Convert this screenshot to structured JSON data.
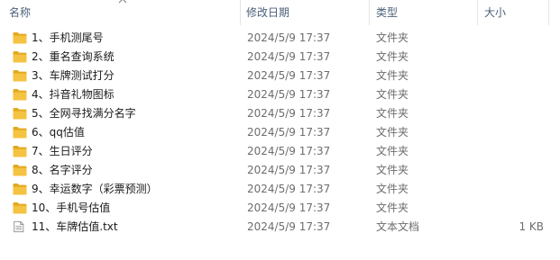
{
  "columns": {
    "name": "名称",
    "date": "修改日期",
    "type": "类型",
    "size": "大小"
  },
  "colors": {
    "folder": "#f5c342",
    "folder_dark": "#e3a91e",
    "header_text": "#4c607a"
  },
  "files": [
    {
      "name": "1、手机测尾号",
      "date": "2024/5/9 17:37",
      "type": "文件夹",
      "size": "",
      "icon": "folder-icon"
    },
    {
      "name": "2、重名查询系统",
      "date": "2024/5/9 17:37",
      "type": "文件夹",
      "size": "",
      "icon": "folder-icon"
    },
    {
      "name": "3、车牌测试打分",
      "date": "2024/5/9 17:37",
      "type": "文件夹",
      "size": "",
      "icon": "folder-icon"
    },
    {
      "name": "4、抖音礼物图标",
      "date": "2024/5/9 17:37",
      "type": "文件夹",
      "size": "",
      "icon": "folder-icon"
    },
    {
      "name": "5、全网寻找满分名字",
      "date": "2024/5/9 17:37",
      "type": "文件夹",
      "size": "",
      "icon": "folder-icon"
    },
    {
      "name": "6、qq估值",
      "date": "2024/5/9 17:37",
      "type": "文件夹",
      "size": "",
      "icon": "folder-icon"
    },
    {
      "name": "7、生日评分",
      "date": "2024/5/9 17:37",
      "type": "文件夹",
      "size": "",
      "icon": "folder-icon"
    },
    {
      "name": "8、名字评分",
      "date": "2024/5/9 17:37",
      "type": "文件夹",
      "size": "",
      "icon": "folder-icon"
    },
    {
      "name": "9、幸运数字（彩票预测）",
      "date": "2024/5/9 17:37",
      "type": "文件夹",
      "size": "",
      "icon": "folder-icon"
    },
    {
      "name": "10、手机号估值",
      "date": "2024/5/9 17:37",
      "type": "文件夹",
      "size": "",
      "icon": "folder-icon"
    },
    {
      "name": "11、车牌估值.txt",
      "date": "2024/5/9 17:37",
      "type": "文本文档",
      "size": "1 KB",
      "icon": "text-file-icon"
    }
  ]
}
